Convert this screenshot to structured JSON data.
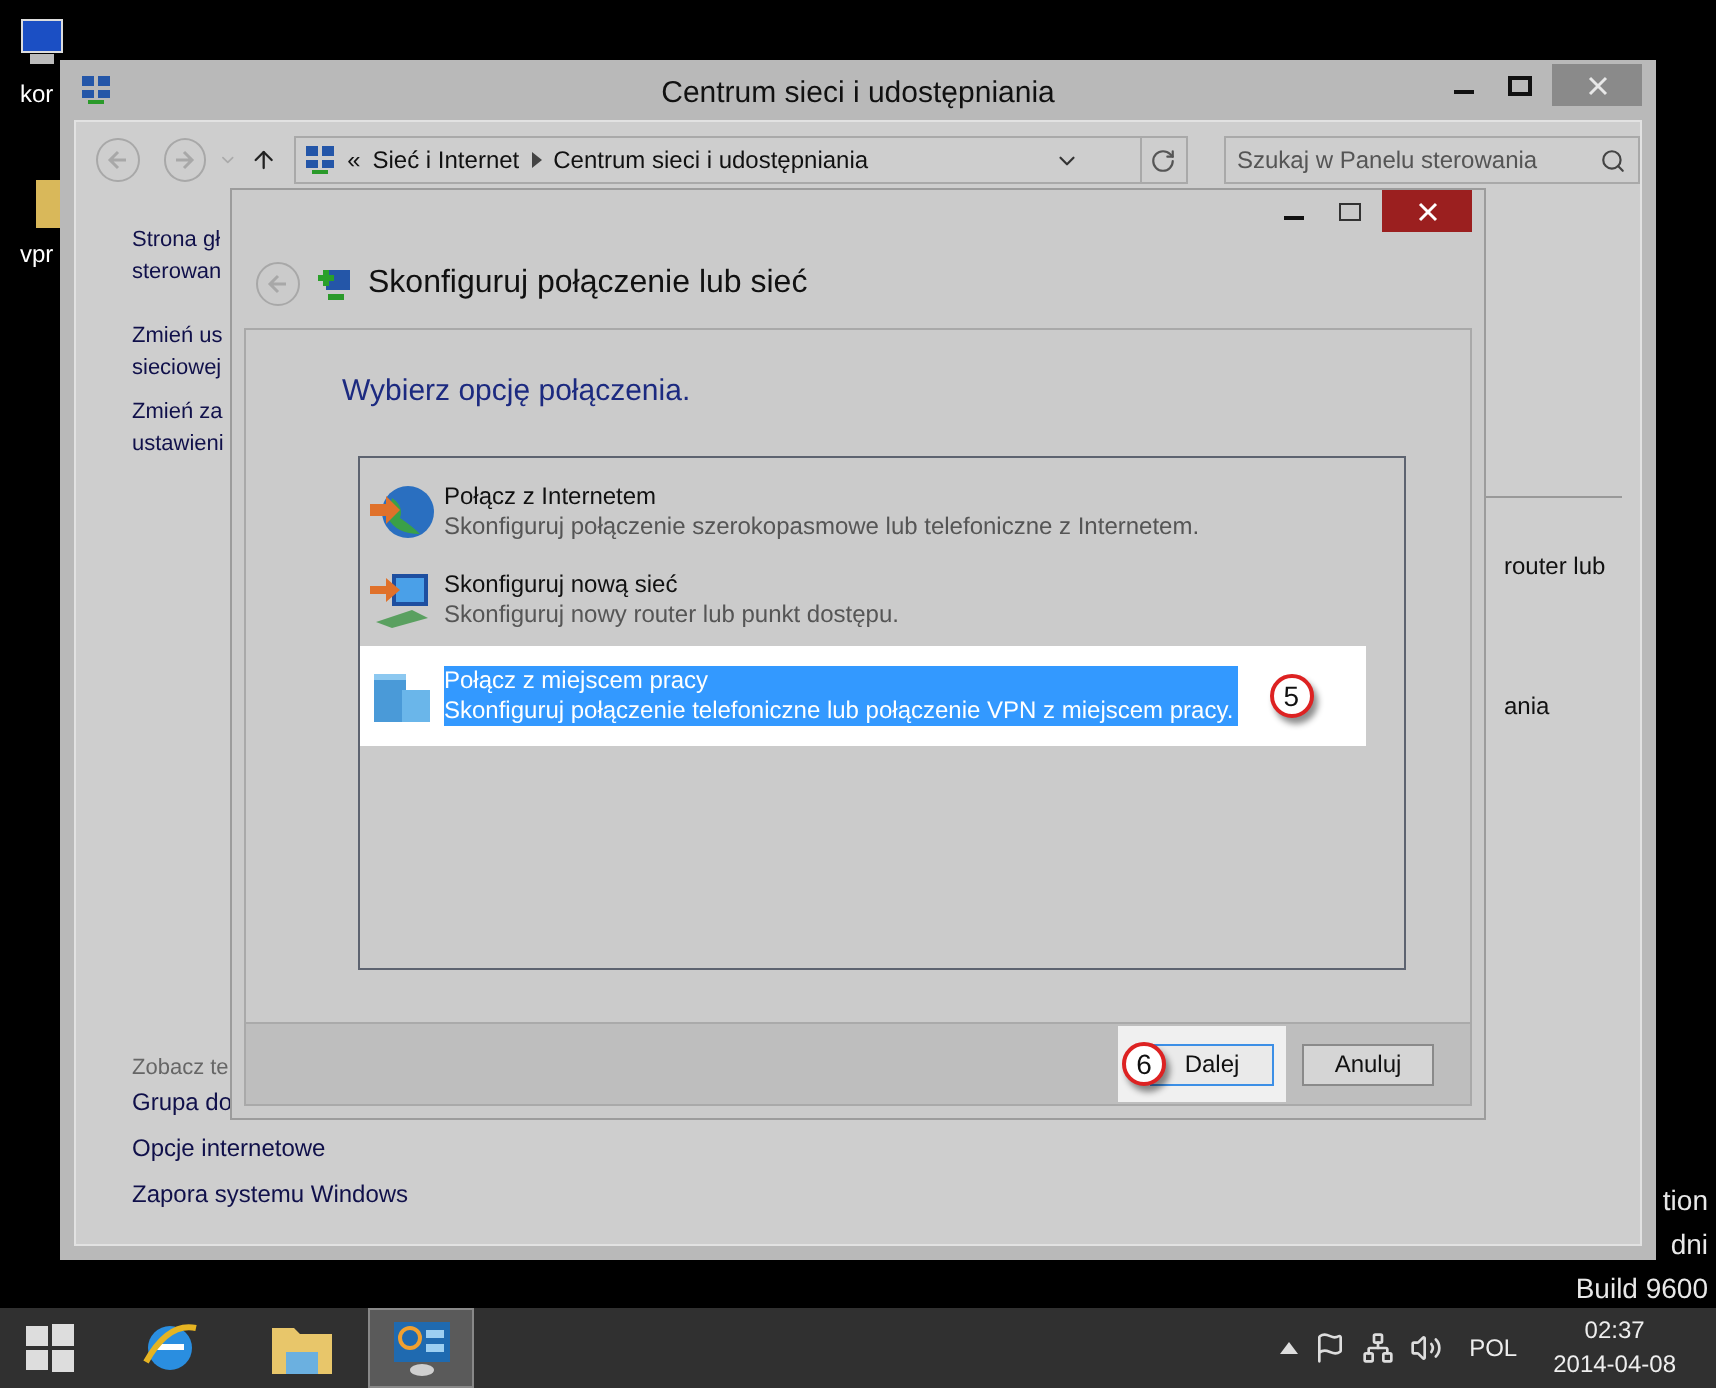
{
  "desktop": {
    "icons": [
      {
        "label": "kor"
      },
      {
        "label": "vpr"
      }
    ],
    "watermark_lines": [
      "tion",
      "dni",
      "Build 9600"
    ]
  },
  "window": {
    "title": "Centrum sieci i udostępniania",
    "address": {
      "overflow": "«",
      "crumbs": [
        "Sieć i Internet",
        "Centrum sieci i udostępniania"
      ]
    },
    "search": {
      "placeholder": "Szukaj w Panelu sterowania"
    },
    "sidebar_links": [
      "Strona gł\nsterowan",
      "Zmień us\nsieciowej",
      "Zmień za\nustawieni"
    ],
    "see_also": {
      "heading": "Zobacz te",
      "links": [
        "Grupa do",
        "Opcje internetowe",
        "Zapora systemu Windows"
      ]
    },
    "right_pane": [
      "router lub",
      "ania"
    ]
  },
  "dialog": {
    "title": "Skonfiguruj połączenie lub sieć",
    "heading": "Wybierz opcję połączenia.",
    "options": [
      {
        "title": "Połącz z Internetem",
        "description": "Skonfiguruj połączenie szerokopasmowe lub telefoniczne z Internetem.",
        "selected": false
      },
      {
        "title": "Skonfiguruj nową sieć",
        "description": "Skonfiguruj nowy router lub punkt dostępu.",
        "selected": false
      },
      {
        "title": "Połącz z miejscem pracy",
        "description": "Skonfiguruj połączenie telefoniczne lub połączenie VPN z miejscem pracy.",
        "selected": true,
        "callout": "5"
      }
    ],
    "buttons": [
      {
        "label": "Dalej",
        "default": true,
        "callout": "6"
      },
      {
        "label": "Anuluj",
        "default": false
      }
    ]
  },
  "taskbar": {
    "apps": [
      {
        "selected": false
      },
      {
        "selected": false
      },
      {
        "selected": true
      }
    ],
    "language": "POL",
    "time": "02:37",
    "date": "2014-04-08"
  }
}
